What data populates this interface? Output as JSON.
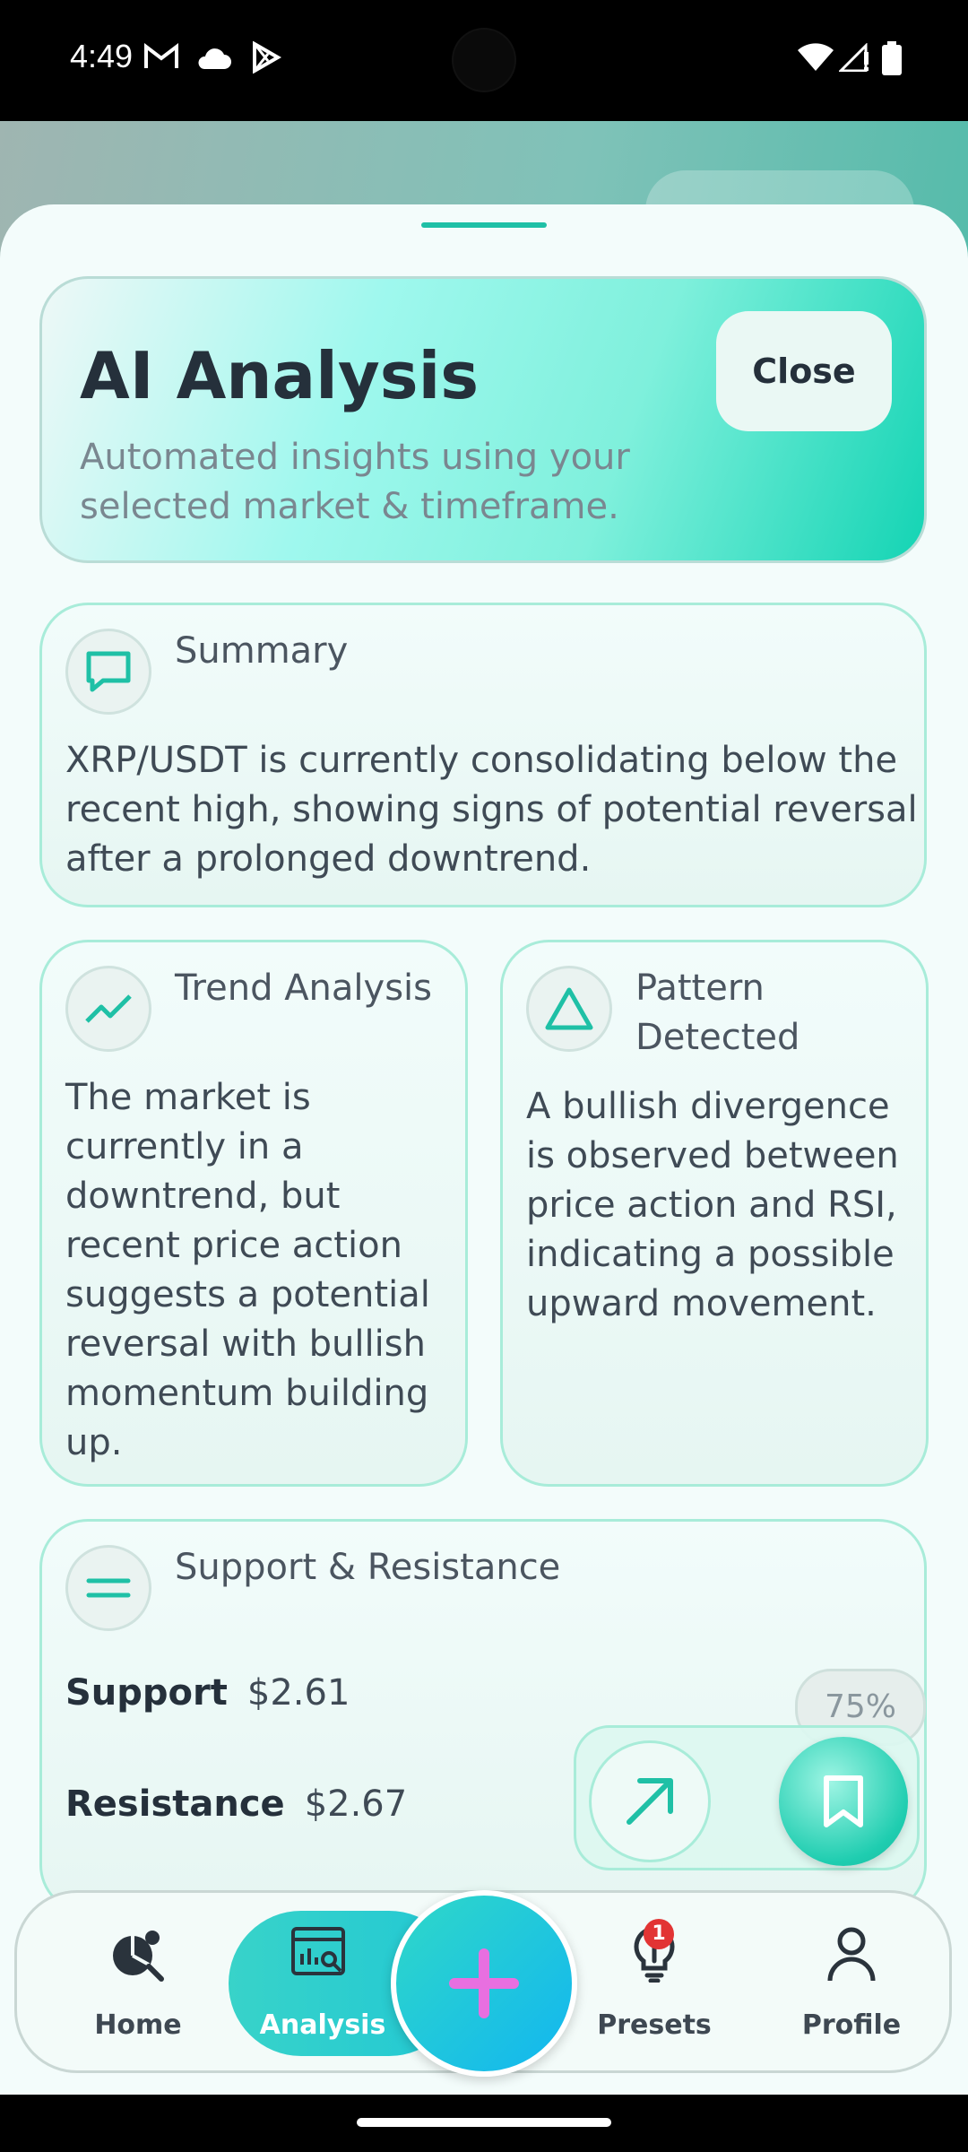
{
  "status_bar": {
    "time": "4:49",
    "icons": [
      "gmail-icon",
      "cloud-icon",
      "play-store-icon",
      "wifi-icon",
      "signal-icon",
      "battery-icon"
    ]
  },
  "header": {
    "title": "AI Analysis",
    "subtitle": "Automated insights using your selected market & timeframe.",
    "close_label": "Close"
  },
  "summary": {
    "title": "Summary",
    "icon": "chat-bubble-icon",
    "body": "XRP/USDT is currently consolidating below the recent high, showing signs of potential reversal after a prolonged downtrend."
  },
  "trend": {
    "title": "Trend Analysis",
    "icon": "trend-line-icon",
    "body": "The market is currently in a downtrend, but recent price action suggests a potential reversal with bullish momentum building up."
  },
  "pattern": {
    "title": "Pattern Detected",
    "icon": "triangle-icon",
    "body": "A bullish divergence is observed between price action and RSI, indicating a possible upward movement."
  },
  "support_resistance": {
    "title": "Support & Resistance",
    "icon": "equals-icon",
    "support_label": "Support",
    "support_value": "$2.61",
    "resistance_label": "Resistance",
    "resistance_value": "$2.67",
    "confidence": "75%"
  },
  "fab": {
    "trend_icon": "arrow-up-right-icon",
    "bookmark_icon": "bookmark-icon"
  },
  "nav": {
    "items": [
      {
        "label": "Home",
        "icon": "home-analytics-icon"
      },
      {
        "label": "Analysis",
        "icon": "analysis-chart-icon"
      },
      {
        "label": "Presets",
        "icon": "lightbulb-icon",
        "badge": "1"
      },
      {
        "label": "Profile",
        "icon": "user-icon"
      }
    ],
    "add_icon": "plus-icon"
  },
  "colors": {
    "accent": "#1fc0a6",
    "analysis_tab": "#30cfcb",
    "add_button": "#19c0e6",
    "plus": "#e86fe0",
    "badge": "#e23434"
  }
}
